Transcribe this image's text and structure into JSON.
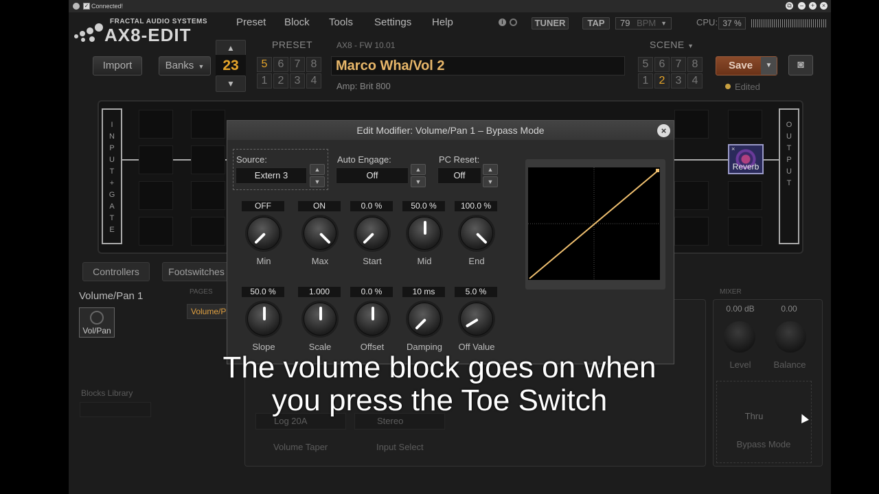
{
  "titlebar": {
    "status": "Connected!"
  },
  "logo": {
    "company": "FRACTAL AUDIO SYSTEMS",
    "product": "AX8-EDIT"
  },
  "menu": [
    "Preset",
    "Block",
    "Tools",
    "Settings",
    "Help"
  ],
  "header": {
    "tuner": "TUNER",
    "tap": "TAP",
    "tempo": "79",
    "tempo_unit": "BPM",
    "cpu_label": "CPU:",
    "cpu_value": "37 %"
  },
  "preset": {
    "import_label": "Import",
    "banks_label": "Banks",
    "number": "23",
    "section_label": "PRESET",
    "row_top": [
      "5",
      "6",
      "7",
      "8"
    ],
    "row_bottom": [
      "1",
      "2",
      "3",
      "4"
    ],
    "firmware": "AX8 - FW 10.01",
    "name": "Marco Wha/Vol 2",
    "amp": "Amp: Brit 800"
  },
  "scene": {
    "section_label": "SCENE",
    "row_top": [
      "5",
      "6",
      "7",
      "8"
    ],
    "row_bottom": [
      "1",
      "2",
      "3",
      "4"
    ],
    "active": "2"
  },
  "save": {
    "label": "Save",
    "status": "Edited"
  },
  "grid": {
    "input_label": "INPUT+GATE",
    "output_label": "OUTPUT",
    "reverb_block": "Reverb"
  },
  "tabs": {
    "controllers": "Controllers",
    "footswitches": "Footswitches"
  },
  "block_panel": {
    "title": "Volume/Pan 1",
    "block_label": "Vol/Pan",
    "pages_label": "PAGES",
    "page_item": "Volume/Pan",
    "library_label": "Blocks Library",
    "taper_value": "Log 20A",
    "taper_label": "Volume Taper",
    "input_select_value": "Stereo",
    "input_select_label": "Input Select"
  },
  "mixer": {
    "section_label": "MIXER",
    "level_value": "0.00 dB",
    "level_label": "Level",
    "balance_value": "0.00",
    "balance_label": "Balance",
    "bypass_value": "Thru",
    "bypass_label": "Bypass Mode"
  },
  "modal": {
    "title": "Edit Modifier: Volume/Pan 1 – Bypass Mode",
    "source_label": "Source:",
    "source_value": "Extern 3",
    "auto_engage_label": "Auto Engage:",
    "auto_engage_value": "Off",
    "pc_reset_label": "PC Reset:",
    "pc_reset_value": "Off",
    "knobs_row1": [
      {
        "label": "Min",
        "value": "OFF",
        "level": 0.0
      },
      {
        "label": "Max",
        "value": "ON",
        "level": 1.0
      },
      {
        "label": "Start",
        "value": "0.0 %",
        "level": 0.0
      },
      {
        "label": "Mid",
        "value": "50.0 %",
        "level": 0.5
      },
      {
        "label": "End",
        "value": "100.0 %",
        "level": 1.0
      }
    ],
    "knobs_row2": [
      {
        "label": "Slope",
        "value": "50.0 %",
        "level": 0.5
      },
      {
        "label": "Scale",
        "value": "1.000",
        "level": 0.5
      },
      {
        "label": "Offset",
        "value": "0.0 %",
        "level": 0.5
      },
      {
        "label": "Damping",
        "value": "10 ms",
        "level": 0.0
      },
      {
        "label": "Off Value",
        "value": "5.0 %",
        "level": 0.05
      }
    ],
    "curve_color": "#f0c070"
  },
  "subtitle": {
    "line1": "The volume block goes on when",
    "line2": "you press the Toe Switch"
  },
  "colors": {
    "accent": "#e6a52a",
    "save": "#7a3a1e"
  }
}
